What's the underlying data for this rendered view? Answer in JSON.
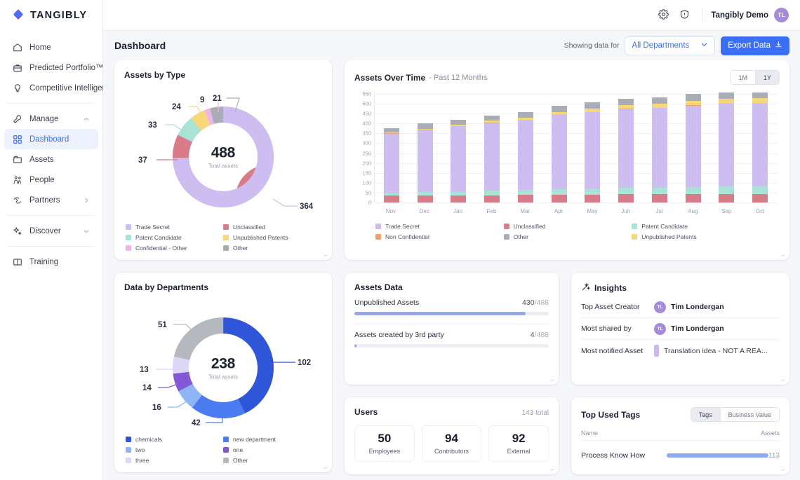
{
  "brand": {
    "name": "TANGIBLY",
    "logo_icon": "diamond-logo-icon",
    "accent": "#3b6ef5"
  },
  "topbar": {
    "settings_icon": "gear-icon",
    "help_icon": "shield-icon",
    "account_name": "Tangibly Demo",
    "avatar_initials": "TL",
    "avatar_color": "#a78bda"
  },
  "sidebar": {
    "items": [
      {
        "label": "Home",
        "icon": "home-icon",
        "active": false
      },
      {
        "label": "Predicted Portfolio™",
        "icon": "briefcase-icon",
        "active": false
      },
      {
        "label": "Competitive Intelligence",
        "icon": "lightbulb-icon",
        "active": false
      },
      {
        "label": "Manage",
        "icon": "wrench-icon",
        "active": false,
        "chevron": "chevron-up"
      },
      {
        "label": "Dashboard",
        "icon": "grid-icon",
        "active": true
      },
      {
        "label": "Assets",
        "icon": "folder-icon",
        "active": false
      },
      {
        "label": "People",
        "icon": "people-icon",
        "active": false
      },
      {
        "label": "Partners",
        "icon": "handshake-icon",
        "active": false,
        "chevron": "chevron-right"
      },
      {
        "label": "Discover",
        "icon": "sparkle-icon",
        "active": false,
        "chevron": "chevron-down"
      },
      {
        "label": "Training",
        "icon": "book-icon",
        "active": false
      }
    ]
  },
  "subbar": {
    "title": "Dashboard",
    "showing_label": "Showing data for",
    "department_value": "All Departments",
    "export_label": "Export Data",
    "export_icon": "download-icon"
  },
  "assets_by_type": {
    "title": "Assets by Type",
    "total": "488",
    "caption": "Total assets"
  },
  "assets_over_time": {
    "title": "Assets Over Time",
    "subtitle": "- Past 12 Months",
    "range_options": [
      "1M",
      "1Y"
    ],
    "range_selected": "1Y"
  },
  "departments": {
    "title": "Data by Departments",
    "total": "238",
    "caption": "Total assets"
  },
  "assets_data": {
    "title": "Assets Data",
    "rows": [
      {
        "label": "Unpublished Assets",
        "value": "430",
        "denominator": "/488",
        "pct": 88.1
      },
      {
        "label": "Assets created by 3rd party",
        "value": "4",
        "denominator": "/488",
        "pct": 1.2
      }
    ]
  },
  "insights": {
    "title": "Insights",
    "icon": "magic-wand-icon",
    "rows": [
      {
        "label": "Top Asset Creator",
        "value": "Tim Londergan",
        "type": "user",
        "initials": "TL"
      },
      {
        "label": "Most shared by",
        "value": "Tim Londergan",
        "type": "user",
        "initials": "TL"
      },
      {
        "label": "Most notified Asset",
        "value": "Translation idea - NOT A REA...",
        "type": "asset"
      }
    ]
  },
  "users": {
    "title": "Users",
    "total_label": "143 total",
    "stats": [
      {
        "number": "50",
        "label": "Employees"
      },
      {
        "number": "94",
        "label": "Contributors"
      },
      {
        "number": "92",
        "label": "External"
      }
    ]
  },
  "tags": {
    "title": "Top Used Tags",
    "toggle_options": [
      "Tags",
      "Business Value"
    ],
    "toggle_selected": "Tags",
    "col_name": "Name",
    "col_assets": "Assets",
    "rows": [
      {
        "name": "Process Know How",
        "count": "113",
        "pct": 96
      }
    ]
  },
  "chart_data": [
    {
      "type": "pie",
      "title": "Assets by Type",
      "center_value": 488,
      "center_label": "Total assets",
      "labels": [
        "Trade Secret",
        "Unclassified",
        "Patent Candidate",
        "Unpublished Patents",
        "Confidential - Other",
        "Other"
      ],
      "values": [
        364,
        37,
        33,
        24,
        9,
        21
      ],
      "colors": [
        "#cdbdf0",
        "#d87c87",
        "#a9e3d5",
        "#f6d879",
        "#efb5e8",
        "#a9adb6"
      ],
      "legend_position": "bottom",
      "callouts": [
        364,
        37,
        33,
        24,
        9,
        21
      ]
    },
    {
      "type": "bar",
      "title": "Assets Over Time",
      "subtitle": "Past 12 Months",
      "stacked": true,
      "categories": [
        "Nov",
        "Dec",
        "Jan",
        "Feb",
        "Mar",
        "Apr",
        "May",
        "Jun",
        "Jul",
        "Aug",
        "Sep",
        "Oct"
      ],
      "ylim": [
        0,
        560
      ],
      "yticks": [
        0,
        50,
        100,
        150,
        200,
        250,
        300,
        350,
        400,
        450,
        500,
        550
      ],
      "ylabel": "",
      "xlabel": "",
      "grid": true,
      "legend_position": "bottom",
      "series": [
        {
          "name": "Unclassified",
          "color": "#d87c87",
          "values": [
            35,
            35,
            35,
            37,
            38,
            39,
            40,
            41,
            42,
            43,
            44,
            44
          ]
        },
        {
          "name": "Patent Candidate",
          "color": "#a9e3d5",
          "values": [
            15,
            17,
            18,
            22,
            26,
            29,
            31,
            33,
            34,
            35,
            36,
            37
          ]
        },
        {
          "name": "Trade Secret",
          "color": "#cdbdf0",
          "values": [
            298,
            313,
            333,
            343,
            353,
            377,
            386,
            399,
            402,
            412,
            422,
            422
          ]
        },
        {
          "name": "Non Confidential",
          "color": "#efa06a",
          "values": [
            4,
            3,
            2,
            1,
            1,
            1,
            1,
            1,
            1,
            1,
            1,
            1
          ]
        },
        {
          "name": "Unpublished Patents",
          "color": "#f6d879",
          "values": [
            1,
            6,
            7,
            11,
            12,
            13,
            17,
            19,
            21,
            22,
            23,
            23
          ]
        },
        {
          "name": "Other",
          "color": "#a9adb6",
          "values": [
            22,
            25,
            24,
            24,
            29,
            29,
            32,
            32,
            33,
            35,
            31,
            31
          ]
        }
      ]
    },
    {
      "type": "pie",
      "title": "Data by Departments",
      "center_value": 238,
      "center_label": "Total assets",
      "labels": [
        "chemicals",
        "new department",
        "two",
        "one",
        "three",
        "Other"
      ],
      "values": [
        102,
        42,
        16,
        14,
        13,
        51
      ],
      "colors": [
        "#2f56d8",
        "#4a7bf0",
        "#8fb4f7",
        "#8358d4",
        "#ded6f7",
        "#b4b8bf"
      ],
      "legend_position": "bottom",
      "callouts": [
        102,
        42,
        16,
        14,
        13,
        51
      ]
    }
  ]
}
